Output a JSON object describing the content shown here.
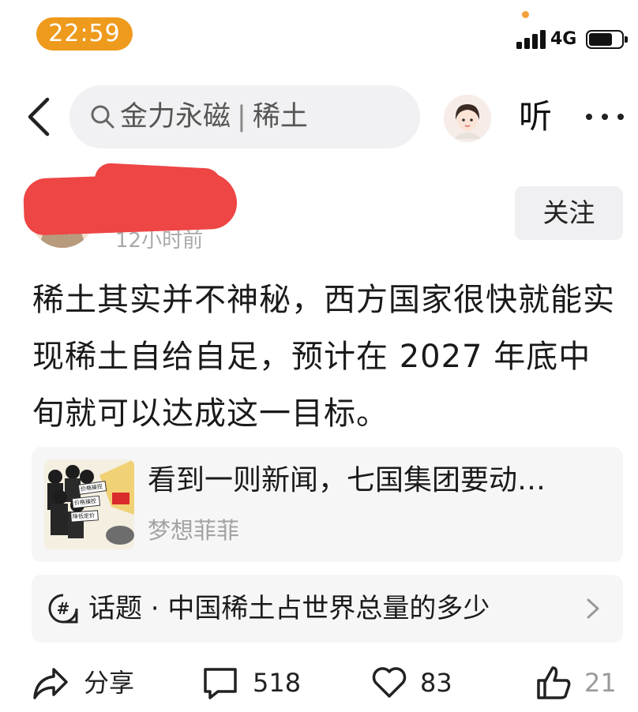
{
  "status_bar": {
    "time": "22:59",
    "network": "4G",
    "battery_level": 0.75
  },
  "header": {
    "search_query": [
      "金力永磁",
      "稀土"
    ],
    "search_separator": "|",
    "listen_label": "听"
  },
  "author": {
    "post_time": "12小时前",
    "follow_label": "关注"
  },
  "post": {
    "text": "稀土其实并不神秘，西方国家很快就能实现稀土自给自足，预计在 2027 年底中旬就可以达成这一目标。"
  },
  "linked_card": {
    "title": "看到一则新闻，七国集团要动…",
    "author": "梦想菲菲",
    "thumbnail_labels": [
      "价格操控",
      "价格操控",
      "降低定价"
    ]
  },
  "topic": {
    "label": "话题 · 中国稀土占世界总量的多少"
  },
  "actions": {
    "share_label": "分享",
    "comments_count": "518",
    "likes_count": "83",
    "third_count": "21"
  },
  "colors": {
    "time_pill": "#ee9a1c",
    "redaction": "#ee4545",
    "card_bg": "#f6f6f7",
    "muted_text": "#a3a3a3"
  }
}
